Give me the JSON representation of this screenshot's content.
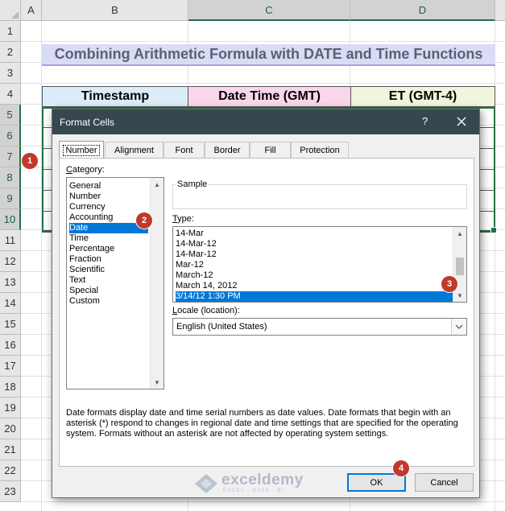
{
  "sheet": {
    "columns": [
      "A",
      "B",
      "C",
      "D"
    ],
    "rows": [
      "1",
      "2",
      "3",
      "4",
      "5",
      "6",
      "7",
      "8",
      "9",
      "10",
      "11",
      "12",
      "13",
      "14",
      "15",
      "16",
      "17",
      "18",
      "19",
      "20",
      "21",
      "22",
      "23"
    ],
    "title": "Combining Arithmetic Formula with DATE and Time Functions",
    "table_headers": [
      "Timestamp",
      "Date Time (GMT)",
      "ET (GMT-4)"
    ],
    "colors": {
      "title_fill": "#dadcf5",
      "ts_fill": "#dcecf8",
      "dt_fill": "#fad6ea",
      "et_fill": "#eef7dc",
      "selection": "#217346"
    }
  },
  "dialog": {
    "title": "Format Cells",
    "help": "?",
    "close_icon": "close-icon",
    "tabs": [
      "Number",
      "Alignment",
      "Font",
      "Border",
      "Fill",
      "Protection"
    ],
    "active_tab": "Number",
    "category_label": "Category:",
    "categories": [
      "General",
      "Number",
      "Currency",
      "Accounting",
      "Date",
      "Time",
      "Percentage",
      "Fraction",
      "Scientific",
      "Text",
      "Special",
      "Custom"
    ],
    "selected_category": "Date",
    "sample_label": "Sample",
    "type_label": "Type:",
    "types": [
      "14-Mar",
      "14-Mar-12",
      "14-Mar-12",
      "Mar-12",
      "March-12",
      "March 14, 2012",
      "3/14/12 1:30 PM"
    ],
    "selected_type": "3/14/12 1:30 PM",
    "locale_label": "Locale (location):",
    "locale_value": "English (United States)",
    "description": "Date formats display date and time serial numbers as date values.  Date formats that begin with an asterisk (*) respond to changes in regional date and time settings that are specified for the operating system. Formats without an asterisk are not affected by operating system settings.",
    "ok_label": "OK",
    "cancel_label": "Cancel",
    "accent": "#0078d7",
    "titlebar_color": "#37474f"
  },
  "watermark": {
    "name": "exceldemy",
    "sub": "EXCEL · DATA · BI"
  },
  "badges": [
    "1",
    "2",
    "3",
    "4"
  ],
  "badge_color": "#c0392b"
}
